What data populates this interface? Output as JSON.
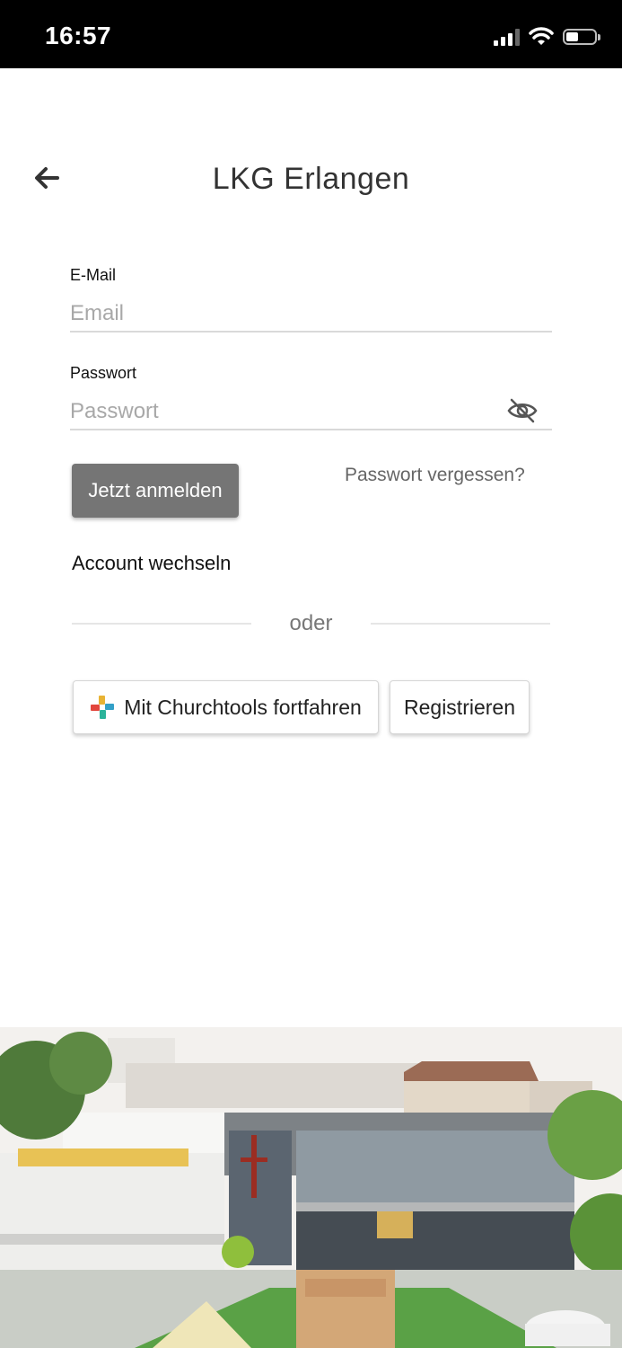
{
  "status_bar": {
    "time": "16:57"
  },
  "header": {
    "title": "LKG Erlangen"
  },
  "form": {
    "email_label": "E-Mail",
    "email_placeholder": "Email",
    "password_label": "Passwort",
    "password_placeholder": "Passwort"
  },
  "actions": {
    "login_label": "Jetzt anmelden",
    "forgot_label": "Passwort vergessen?",
    "switch_account_label": "Account wechseln",
    "divider_label": "oder",
    "churchtools_label": "Mit Churchtools fortfahren",
    "register_label": "Registrieren"
  },
  "colors": {
    "login_button": "#757575",
    "status_bar": "#000000"
  },
  "icons": [
    "back-arrow-icon",
    "eye-off-icon",
    "churchtools-logo-icon",
    "wifi-icon",
    "signal-icon",
    "battery-icon"
  ]
}
